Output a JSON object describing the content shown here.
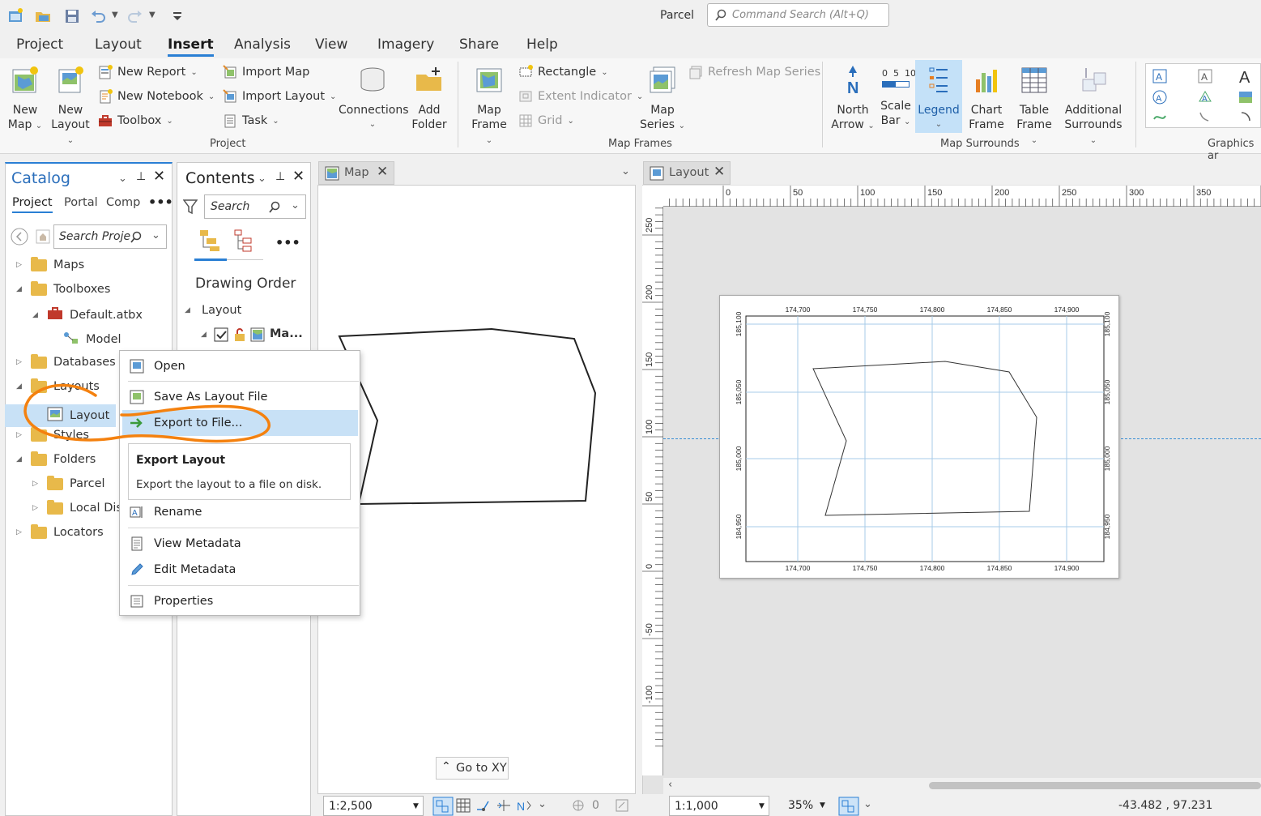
{
  "app": {
    "title": "Parcel",
    "search_placeholder": "Command Search (Alt+Q)"
  },
  "menu_tabs": [
    "Project",
    "Layout",
    "Insert",
    "Analysis",
    "View",
    "Imagery",
    "Share",
    "Help"
  ],
  "active_tab": "Insert",
  "ribbon": {
    "project": {
      "new_map": [
        "New",
        "Map"
      ],
      "new_layout": [
        "New",
        "Layout"
      ],
      "new_report": "New Report",
      "new_notebook": "New Notebook",
      "toolbox": "Toolbox",
      "import_map": "Import Map",
      "import_layout": "Import Layout",
      "task": "Task",
      "connections": "Connections",
      "add_folder": [
        "Add",
        "Folder"
      ],
      "group": "Project"
    },
    "map_frames": {
      "map_frame": [
        "Map",
        "Frame"
      ],
      "rectangle": "Rectangle",
      "extent_indicator": "Extent Indicator",
      "grid": "Grid",
      "map_series": [
        "Map",
        "Series"
      ],
      "refresh_map_series": "Refresh Map Series",
      "group": "Map Frames"
    },
    "map_surrounds": {
      "north_arrow": [
        "North",
        "Arrow"
      ],
      "scale_bar": [
        "Scale",
        "Bar"
      ],
      "scale_bar_ticks": "0  5  10",
      "legend": "Legend",
      "chart_frame": [
        "Chart",
        "Frame"
      ],
      "table_frame": [
        "Table",
        "Frame"
      ],
      "additional_surrounds": [
        "Additional",
        "Surrounds"
      ],
      "group": "Map Surrounds"
    },
    "graphics": {
      "group": "Graphics ar"
    }
  },
  "catalog": {
    "title": "Catalog",
    "tabs": [
      "Project",
      "Portal",
      "Comp"
    ],
    "search_placeholder": "Search Proje",
    "tree": [
      {
        "label": "Maps",
        "indent": 0,
        "exp": "closed"
      },
      {
        "label": "Toolboxes",
        "indent": 0,
        "exp": "open"
      },
      {
        "label": "Default.atbx",
        "indent": 1,
        "exp": "open"
      },
      {
        "label": "Model",
        "indent": 2,
        "exp": "none"
      },
      {
        "label": "Databases",
        "indent": 0,
        "exp": "closed"
      },
      {
        "label": "Layouts",
        "indent": 0,
        "exp": "open"
      },
      {
        "label": "Layout",
        "indent": 1,
        "exp": "none"
      },
      {
        "label": "Styles",
        "indent": 0,
        "exp": "closed"
      },
      {
        "label": "Folders",
        "indent": 0,
        "exp": "open"
      },
      {
        "label": "Parcel",
        "indent": 1,
        "exp": "closed"
      },
      {
        "label": "Local Dis",
        "indent": 1,
        "exp": "closed"
      },
      {
        "label": "Locators",
        "indent": 0,
        "exp": "closed"
      }
    ]
  },
  "contents": {
    "title": "Contents",
    "search_placeholder": "Search",
    "drawing_order": "Drawing Order",
    "layout_node": "Layout",
    "map_node": "Ma..."
  },
  "context_menu": {
    "open": "Open",
    "save_as": "Save As Layout File",
    "export": "Export to File...",
    "tooltip_title": "Export Layout",
    "tooltip_text": "Export the layout to a file on disk.",
    "rename": "Rename",
    "view_metadata": "View Metadata",
    "edit_metadata": "Edit Metadata",
    "properties": "Properties"
  },
  "map_view": {
    "tab": "Map",
    "goto": "Go to XY",
    "scale": "1:2,500",
    "count": "0"
  },
  "layout_view": {
    "tab": "Layout",
    "ruler_top": [
      "0",
      "50",
      "100",
      "150",
      "200",
      "250",
      "300",
      "350"
    ],
    "ruler_left": [
      "250",
      "200",
      "150",
      "100",
      "50",
      "0",
      "-50",
      "-100"
    ],
    "grid_x": [
      "174,700",
      "174,750",
      "174,800",
      "174,850",
      "174,900"
    ],
    "grid_y": [
      "185,100",
      "185,050",
      "185,000",
      "184,950"
    ],
    "scale": "1:1,000",
    "zoom": "35%",
    "coords": "-43.482 , 97.231"
  },
  "colors": {
    "accent": "#2a7fd4",
    "highlight": "#c8e1f6",
    "annotation": "#f4810f",
    "grid": "#a7cbe8"
  }
}
